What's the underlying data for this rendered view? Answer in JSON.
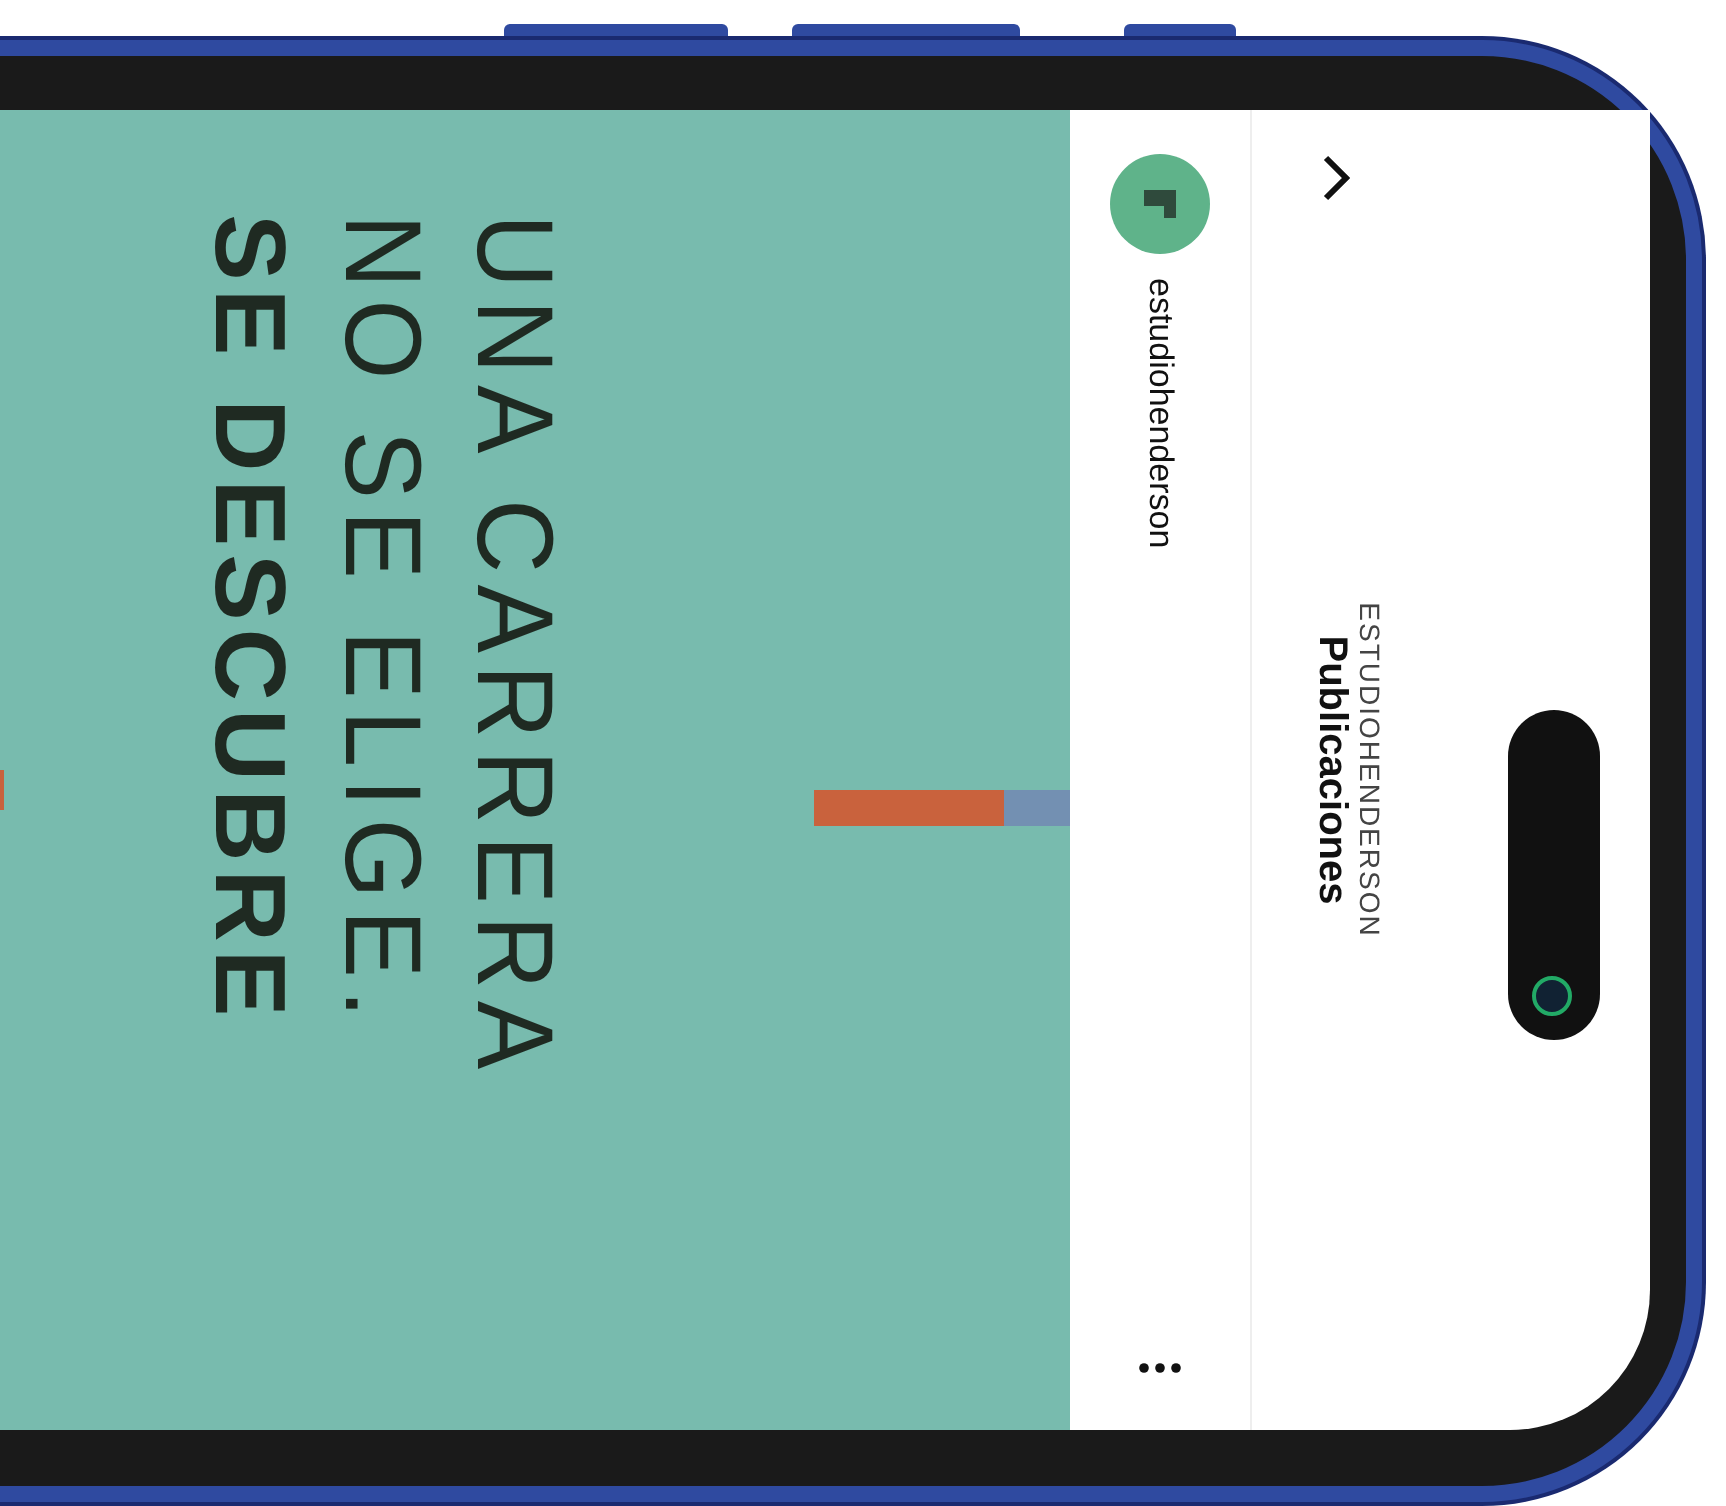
{
  "header": {
    "subtitle": "ESTUDIOHENDERSON",
    "title": "Publicaciones"
  },
  "post": {
    "username": "estudiohenderson",
    "image": {
      "lines": [
        {
          "text": "UNA CARRERA",
          "kind": "light"
        },
        {
          "text": "NO SE ELIGE.",
          "kind": "light"
        },
        {
          "text": "SE DESCUBRE",
          "kind": "bold"
        }
      ]
    }
  }
}
